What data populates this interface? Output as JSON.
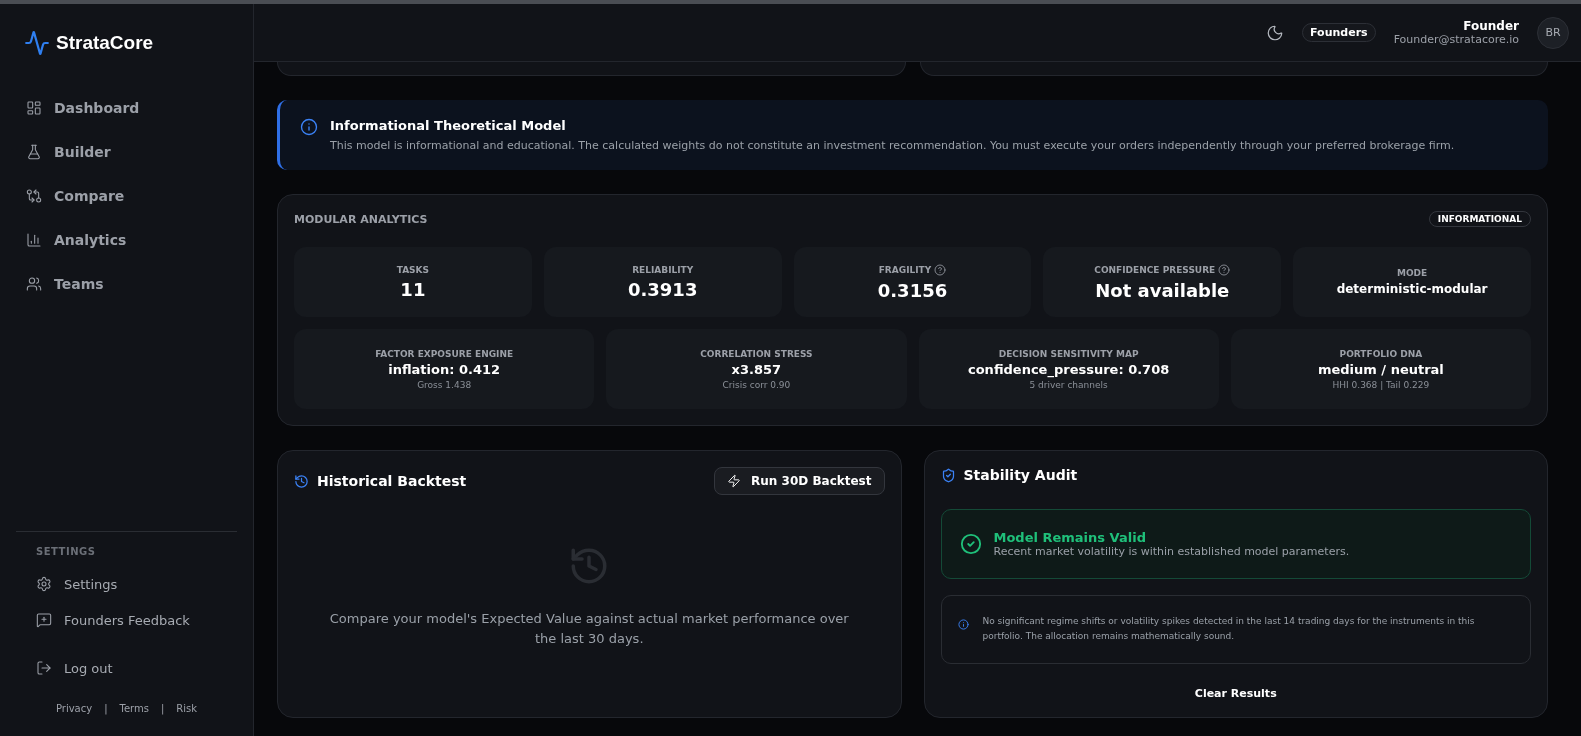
{
  "brand": {
    "name": "StrataCore"
  },
  "nav": [
    {
      "label": "Dashboard",
      "kind": "dashboard"
    },
    {
      "label": "Builder",
      "kind": "builder"
    },
    {
      "label": "Compare",
      "kind": "compare"
    },
    {
      "label": "Analytics",
      "kind": "analytics"
    },
    {
      "label": "Teams",
      "kind": "teams"
    }
  ],
  "settings_section": {
    "heading": "SETTINGS",
    "items": [
      {
        "label": "Settings",
        "kind": "settings"
      },
      {
        "label": "Founders Feedback",
        "kind": "feedback"
      }
    ]
  },
  "logout": {
    "label": "Log out"
  },
  "footer_links": [
    "Privacy",
    "|",
    "Terms",
    "|",
    "Risk"
  ],
  "header": {
    "plan_badge": "Founders",
    "user_name": "Founder",
    "user_email": "Founder@stratacore.io",
    "avatar_initials": "BR"
  },
  "banner": {
    "title": "Informational Theoretical Model",
    "text": "This model is informational and educational. The calculated weights do not constitute an investment recommendation. You must execute your orders independently through your preferred brokerage firm."
  },
  "analytics": {
    "title": "MODULAR ANALYTICS",
    "badge": "INFORMATIONAL",
    "top_metrics": [
      {
        "label": "TASKS",
        "value": "11",
        "help": false,
        "kind": "number"
      },
      {
        "label": "RELIABILITY",
        "value": "0.3913",
        "help": false,
        "kind": "number"
      },
      {
        "label": "FRAGILITY",
        "value": "0.3156",
        "help": true,
        "kind": "number"
      },
      {
        "label": "CONFIDENCE PRESSURE",
        "value": "Not available",
        "help": true,
        "kind": "number"
      },
      {
        "label": "MODE",
        "value": "deterministic-modular",
        "help": false,
        "kind": "text"
      }
    ],
    "engines": [
      {
        "label": "FACTOR EXPOSURE ENGINE",
        "value": "inflation: 0.412",
        "note": "Gross 1.438"
      },
      {
        "label": "CORRELATION STRESS",
        "value": "x3.857",
        "note": "Crisis corr 0.90"
      },
      {
        "label": "DECISION SENSITIVITY MAP",
        "value": "confidence_pressure: 0.708",
        "note": "5 driver channels"
      },
      {
        "label": "PORTFOLIO DNA",
        "value": "medium / neutral",
        "note": "HHI 0.368 | Tail 0.229"
      }
    ]
  },
  "backtest": {
    "title": "Historical Backtest",
    "button": "Run 30D Backtest",
    "empty_text": "Compare your model's Expected Value against actual market performance over the last 30 days."
  },
  "audit": {
    "title": "Stability Audit",
    "status_title": "Model Remains Valid",
    "status_text": "Recent market volatility is within established model parameters.",
    "note": "No significant regime shifts or volatility spikes detected in the last 14 trading days for the instruments in this portfolio. The allocation remains mathematically sound.",
    "clear_button": "Clear Results"
  }
}
